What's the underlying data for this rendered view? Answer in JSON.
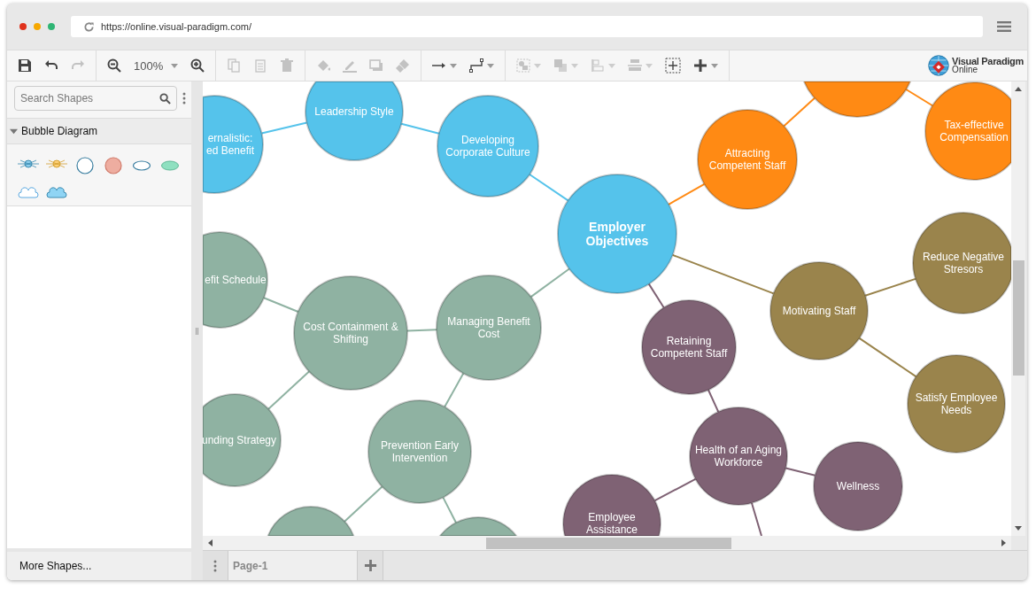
{
  "browser": {
    "url": "https://online.visual-paradigm.com/"
  },
  "toolbar": {
    "zoom": "100%",
    "buttons": [
      {
        "disabled": false
      },
      {
        "disabled": false
      },
      {
        "disabled": true
      },
      {
        "disabled": false
      },
      {
        "disabled": false
      },
      {
        "disabled": true
      },
      {
        "disabled": true
      },
      {
        "disabled": true
      },
      {
        "disabled": true
      },
      {
        "disabled": true
      },
      {
        "disabled": true
      },
      {
        "disabled": true
      },
      {
        "disabled": false
      },
      {
        "disabled": false
      },
      {
        "disabled": true
      },
      {
        "disabled": true
      },
      {
        "disabled": true
      },
      {
        "disabled": true
      },
      {
        "disabled": false
      },
      {
        "disabled": false
      }
    ]
  },
  "logo": {
    "name": "Visual Paradigm",
    "sub": "Online"
  },
  "sidebar": {
    "search": {
      "placeholder": "Search Shapes"
    },
    "section": {
      "title": "Bubble Diagram",
      "expanded": true
    },
    "more": "More Shapes..."
  },
  "diagram": {
    "nodes": [
      {
        "lines": [
          "ernalistic:",
          "ed Benefit"
        ],
        "color": "#55c3eb"
      },
      {
        "lines": [
          "Leadership Style"
        ],
        "color": "#55c3eb"
      },
      {
        "lines": [
          "Developing",
          "Corporate Culture"
        ],
        "color": "#55c3eb"
      },
      {
        "lines": [
          "Employer",
          "Objectives"
        ],
        "color": "#55c3eb"
      },
      {
        "color": "#ff8a14"
      },
      {
        "lines": [
          "Attracting",
          "Competent Staff"
        ],
        "color": "#ff8a14"
      },
      {
        "lines": [
          "Tax-effective",
          "Compensation"
        ],
        "color": "#ff8a14"
      },
      {
        "lines": [
          "Reduce Negative",
          "Stresors"
        ],
        "color": "#9a844c"
      },
      {
        "lines": [
          "Motivating Staff"
        ],
        "color": "#9a844c"
      },
      {
        "lines": [
          "Satisfy Employee",
          "Needs"
        ],
        "color": "#9a844c"
      },
      {
        "lines": [
          "Retaining",
          "Competent Staff"
        ],
        "color": "#7f6274"
      },
      {
        "lines": [
          "Health of an Aging",
          "Workforce"
        ],
        "color": "#7f6274"
      },
      {
        "lines": [
          "Wellness"
        ],
        "color": "#7f6274"
      },
      {
        "lines": [
          "Employee",
          "Assistance"
        ],
        "color": "#7f6274"
      },
      {
        "lines": [
          "efit Schedule"
        ],
        "color": "#8fb2a2"
      },
      {
        "lines": [
          "Cost Containment &",
          "Shifting"
        ],
        "color": "#8fb2a2"
      },
      {
        "lines": [
          "Managing Benefit",
          "Cost"
        ],
        "color": "#8fb2a2"
      },
      {
        "lines": [
          "unding Strategy"
        ],
        "color": "#8fb2a2"
      },
      {
        "lines": [
          "Prevention Early",
          "Intervention"
        ],
        "color": "#8fb2a2"
      },
      {
        "color": "#8fb2a2"
      },
      {
        "color": "#8fb2a2"
      }
    ]
  },
  "pages": [
    {
      "label": "Page-1",
      "selected": true
    }
  ]
}
